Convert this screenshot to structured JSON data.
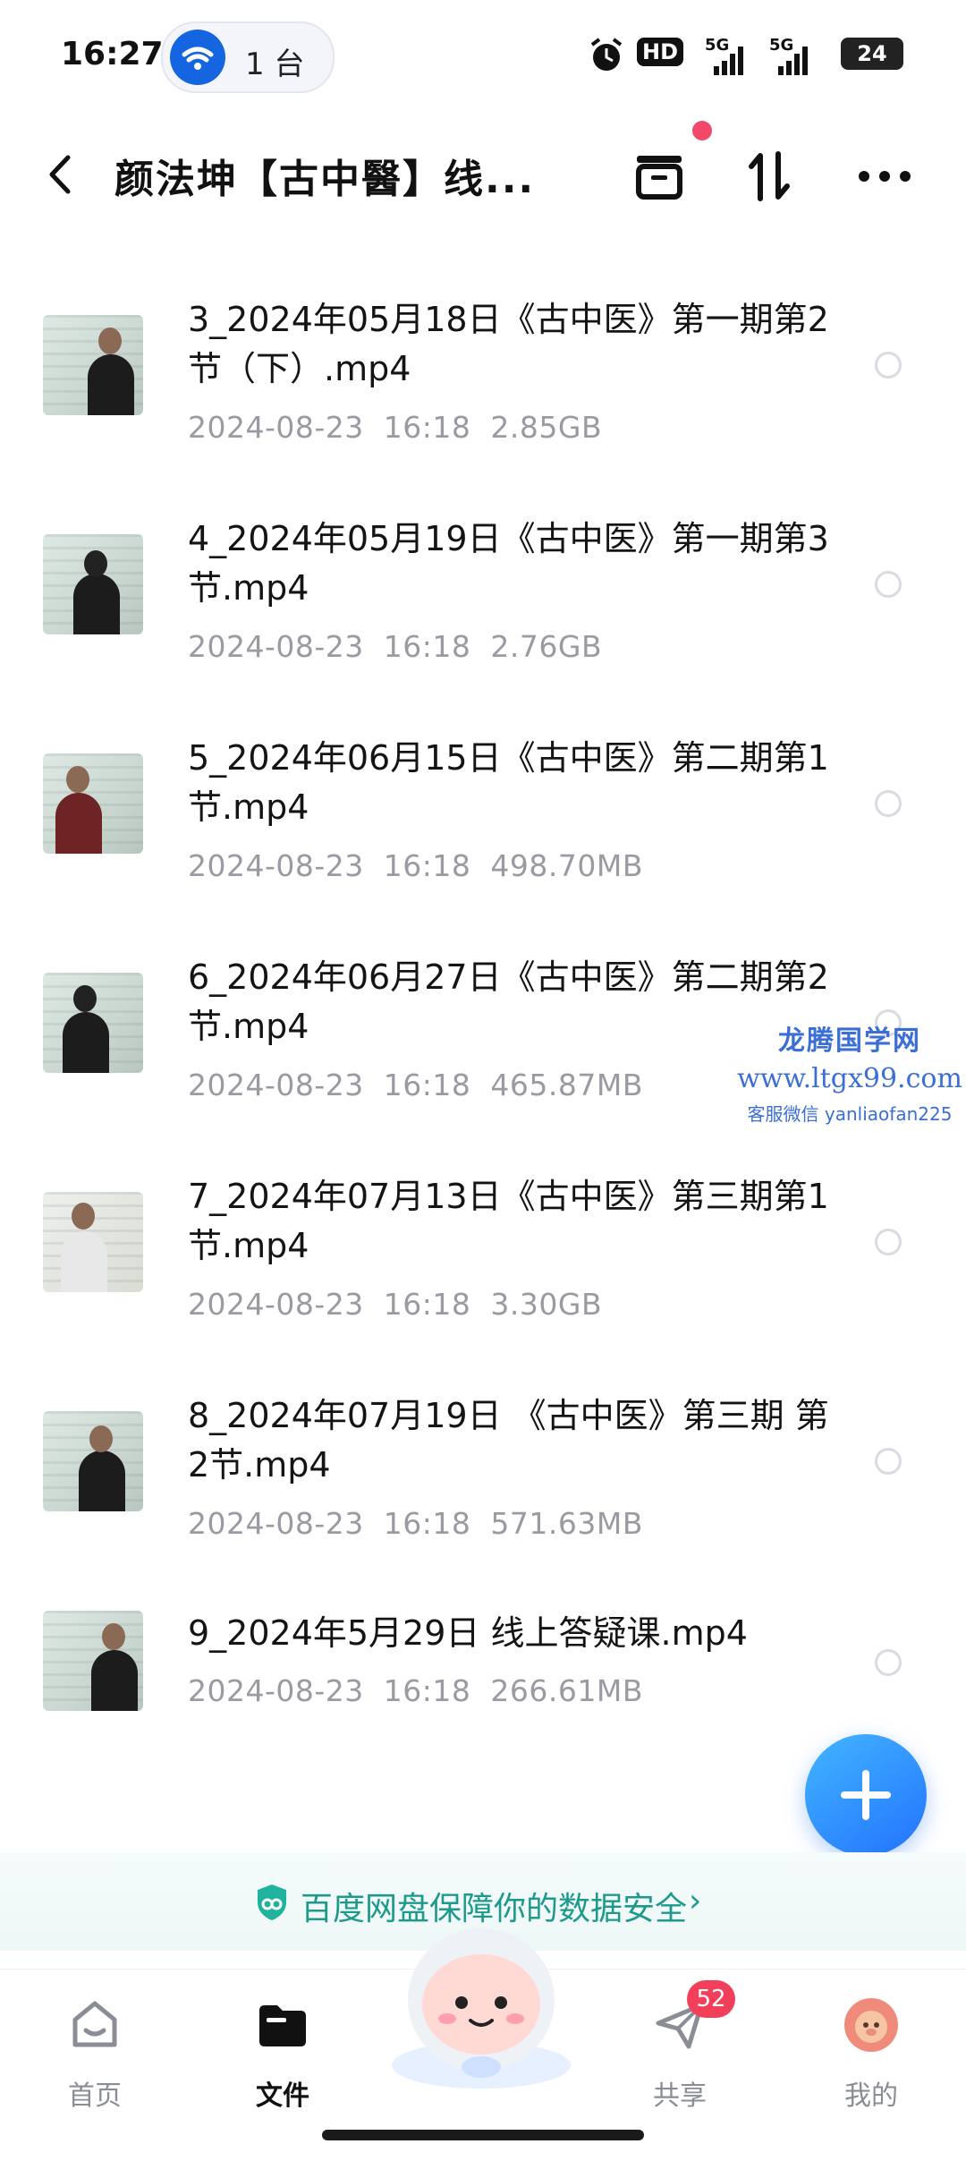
{
  "status_bar": {
    "time": "16:27",
    "device_count": "1 台",
    "hd_label": "HD",
    "sig1_label": "5G",
    "sig2_label": "5G",
    "battery": "24"
  },
  "header": {
    "title": "颜法坤【古中醫】线..."
  },
  "files": [
    {
      "name": "3_2024年05月18日《古中医》第一期第2节（下）.mp4",
      "date": "2024-08-23",
      "time": "16:18",
      "size": "2.85GB"
    },
    {
      "name": "4_2024年05月19日《古中医》第一期第3节.mp4",
      "date": "2024-08-23",
      "time": "16:18",
      "size": "2.76GB"
    },
    {
      "name": "5_2024年06月15日《古中医》第二期第1节.mp4",
      "date": "2024-08-23",
      "time": "16:18",
      "size": "498.70MB"
    },
    {
      "name": "6_2024年06月27日《古中医》第二期第2节.mp4",
      "date": "2024-08-23",
      "time": "16:18",
      "size": "465.87MB"
    },
    {
      "name": "7_2024年07月13日《古中医》第三期第1节.mp4",
      "date": "2024-08-23",
      "time": "16:18",
      "size": "3.30GB"
    },
    {
      "name": "8_2024年07月19日 《古中医》第三期 第2节.mp4",
      "date": "2024-08-23",
      "time": "16:18",
      "size": "571.63MB"
    },
    {
      "name": "9_2024年5月29日 线上答疑课.mp4",
      "date": "2024-08-23",
      "time": "16:18",
      "size": "266.61MB"
    }
  ],
  "watermark": {
    "line1": "龙腾国学网",
    "line2": "www.ltgx99.com",
    "line3": "客服微信 yanliaofan225"
  },
  "banner": {
    "text": "百度网盘保障你的数据安全",
    "chevron": "›"
  },
  "nav": {
    "home": "首页",
    "files": "文件",
    "share": "共享",
    "share_badge": "52",
    "me": "我的"
  }
}
